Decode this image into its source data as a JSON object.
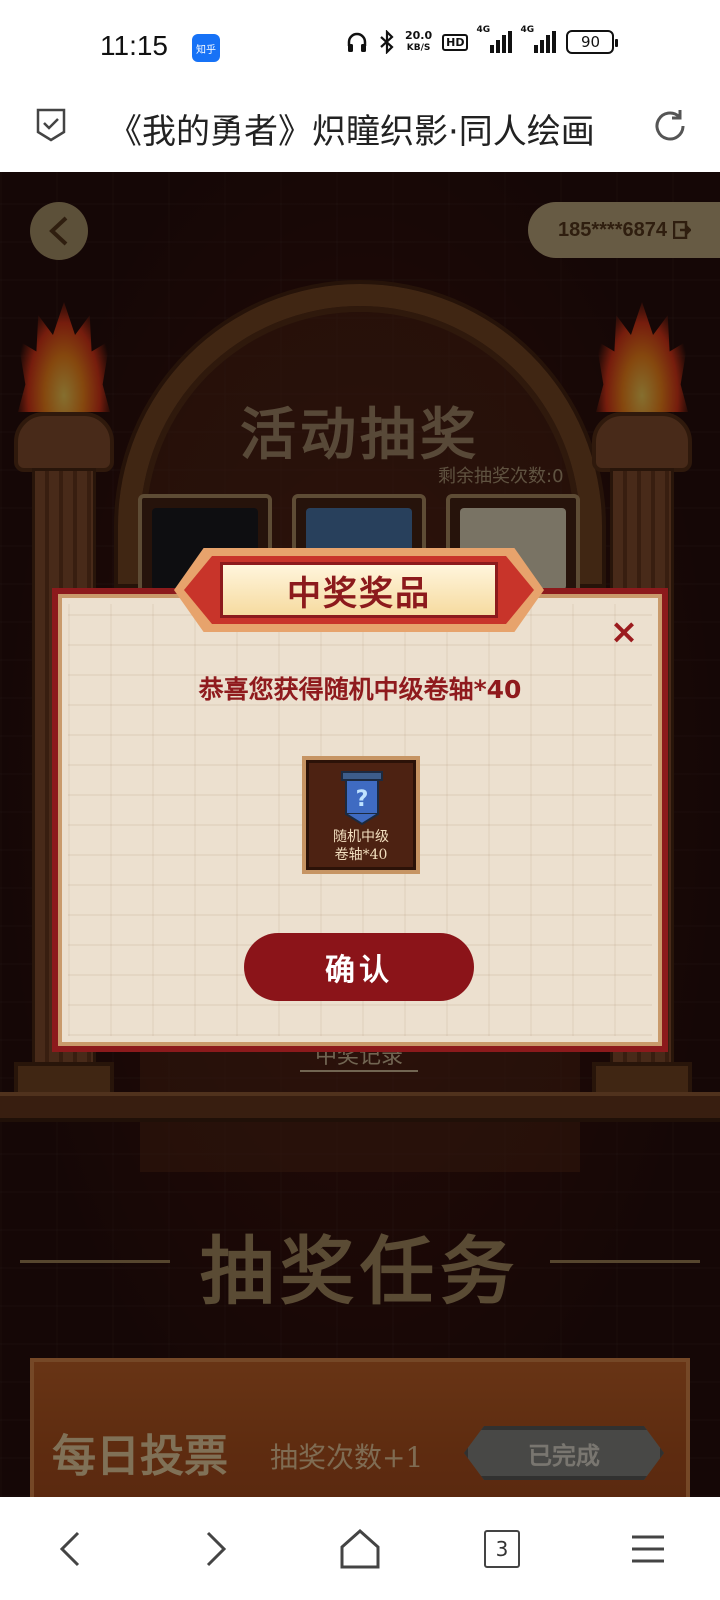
{
  "status_bar": {
    "time": "11:15",
    "app_badge": "知乎",
    "net_speed_value": "20.0",
    "net_speed_unit": "KB/S",
    "hd": "HD",
    "network1": "4G",
    "network2": "4G",
    "battery": "90"
  },
  "browser": {
    "title": "《我的勇者》炽瞳织影·同人绘画"
  },
  "header": {
    "account": "185****6874"
  },
  "activity": {
    "title": "活动抽奖",
    "remaining": "剩余抽奖次数:0",
    "record_link": "中奖记录"
  },
  "tasks": {
    "title": "抽奖任务",
    "items": [
      {
        "name": "每日投票",
        "reward": "抽奖次数+1",
        "status": "已完成"
      }
    ]
  },
  "modal": {
    "banner": "中奖奖品",
    "message": "恭喜您获得随机中级卷轴*40",
    "item_label_line1": "随机中级",
    "item_label_line2": "卷轴*40",
    "confirm": "确认",
    "close": "×"
  },
  "bottom_nav": {
    "tab_count": "3"
  },
  "colors": {
    "modal_border": "#8c1a1c",
    "confirm_button": "#8b1419",
    "zhihu_blue": "#1772f6"
  }
}
